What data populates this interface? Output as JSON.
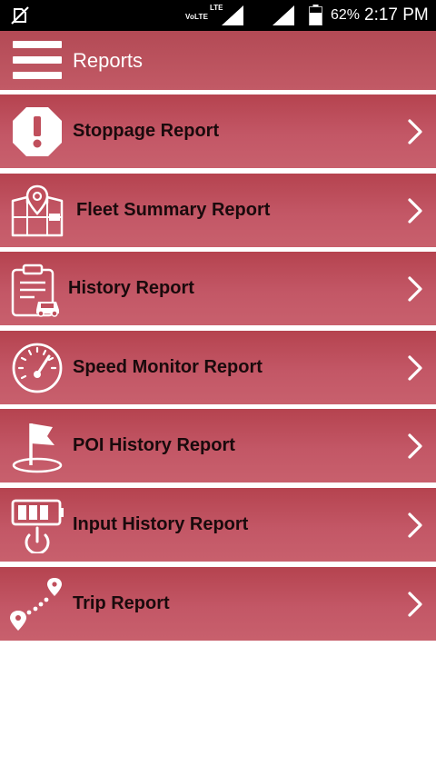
{
  "status_bar": {
    "volte": "VoLTE",
    "lte": "LTE",
    "battery": "62%",
    "time": "2:17 PM"
  },
  "app_bar": {
    "title": "Reports",
    "menu_icon": "hamburger-menu-icon"
  },
  "colors": {
    "accent": "#c04f5c",
    "status_bar": "#000000",
    "label_text": "#1a0a0c",
    "icon": "#ffffff"
  },
  "reports": [
    {
      "label": "Stoppage Report",
      "icon": "stop-alert-icon"
    },
    {
      "label": "Fleet Summary Report",
      "icon": "fleet-map-icon"
    },
    {
      "label": "History Report",
      "icon": "clipboard-car-icon"
    },
    {
      "label": "Speed Monitor Report",
      "icon": "speedometer-icon"
    },
    {
      "label": "POI History Report",
      "icon": "flag-point-icon"
    },
    {
      "label": "Input History Report",
      "icon": "power-input-icon"
    },
    {
      "label": "Trip Report",
      "icon": "route-trip-icon"
    }
  ]
}
